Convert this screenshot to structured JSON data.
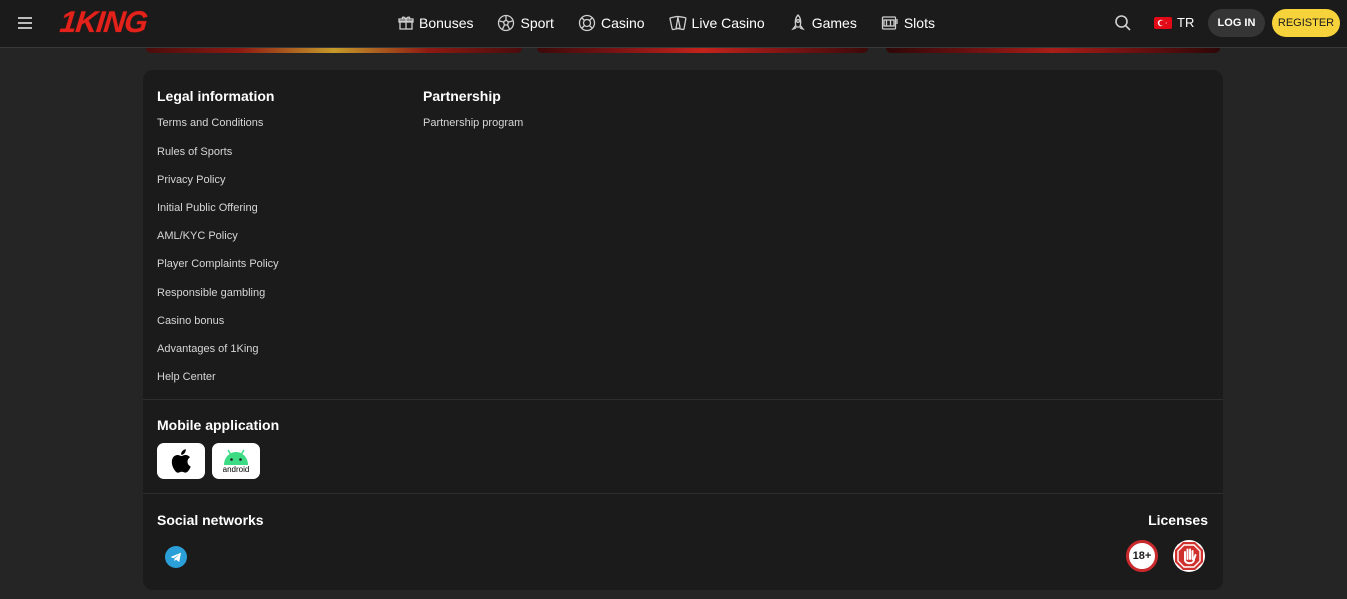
{
  "header": {
    "logo_text": "1KING",
    "nav": [
      {
        "label": "Bonuses",
        "icon": "gift-icon"
      },
      {
        "label": "Sport",
        "icon": "soccer-ball-icon"
      },
      {
        "label": "Casino",
        "icon": "casino-chip-icon"
      },
      {
        "label": "Live Casino",
        "icon": "playing-cards-icon"
      },
      {
        "label": "Games",
        "icon": "rocket-icon"
      },
      {
        "label": "Slots",
        "icon": "slot-machine-icon"
      }
    ],
    "language": "TR",
    "login_label": "LOG IN",
    "register_label": "REGISTER"
  },
  "footer": {
    "legal": {
      "title": "Legal information",
      "links": [
        "Terms and Conditions",
        "Rules of Sports",
        "Privacy Policy",
        "Initial Public Offering",
        "AML/KYC Policy",
        "Player Complaints Policy",
        "Responsible gambling",
        "Casino bonus",
        "Advantages of 1King",
        "Help Center"
      ]
    },
    "partnership": {
      "title": "Partnership",
      "links": [
        "Partnership program"
      ]
    },
    "mobile": {
      "title": "Mobile application",
      "android_label": "android"
    },
    "social": {
      "title": "Social networks"
    },
    "licenses": {
      "title": "Licenses",
      "age_badge": "18+"
    }
  },
  "colors": {
    "brand_red": "#e3221b",
    "register_yellow": "#f6d33b",
    "telegram_blue": "#2a9fd8",
    "page_bg": "#252525",
    "card_bg": "#1b1b1b"
  }
}
